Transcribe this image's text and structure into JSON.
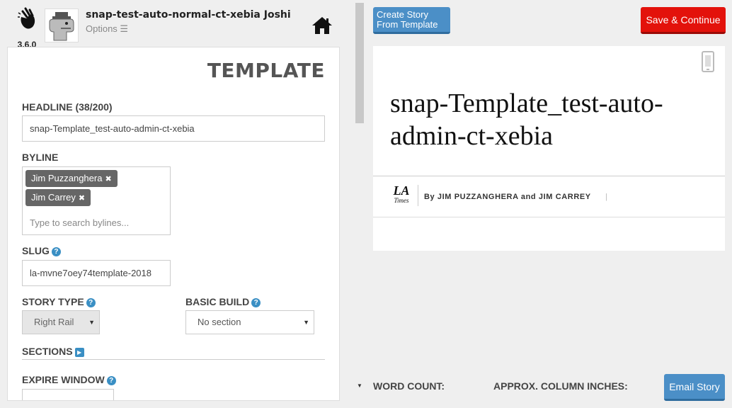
{
  "app": {
    "version": "3.6.0",
    "user_title": "snap-test-auto-normal-ct-xebia Joshi",
    "options_label": "Options ☰"
  },
  "panel": {
    "title": "TEMPLATE",
    "headline_label": "HEADLINE (38/200)",
    "headline_value": "snap-Template_test-auto-admin-ct-xebia",
    "byline_label": "BYLINE",
    "byline_tags": [
      "Jim Puzzanghera",
      "Jim Carrey"
    ],
    "byline_placeholder": "Type to search bylines...",
    "slug_label": "SLUG",
    "slug_value": "la-mvne7oey74template-2018",
    "story_type_label": "STORY TYPE",
    "story_type_value": "Right Rail",
    "basic_build_label": "BASIC BUILD",
    "basic_build_value": "No section",
    "sections_label": "SECTIONS",
    "expire_window_label": "EXPIRE WINDOW"
  },
  "toolbar": {
    "create_story_line1": "Create Story",
    "create_story_line2": "From Template",
    "save_continue": "Save & Continue"
  },
  "preview": {
    "headline": "snap-Template_test-auto-admin-ct-xebia",
    "logo_top": "LA",
    "logo_bottom": "Times",
    "byline": "By JIM PUZZANGHERA and JIM CARREY",
    "byline_sep": "|"
  },
  "footer": {
    "word_count": "WORD COUNT:",
    "column_inches": "APPROX. COLUMN INCHES:",
    "email_story": "Email Story"
  },
  "icons": {
    "logo": "snap-fingers-icon",
    "home": "home-icon",
    "help": "help-icon",
    "mobile": "mobile-icon"
  },
  "colors": {
    "primary_blue": "#4b8fc7",
    "save_red": "#e3120b",
    "help_blue": "#3a8fc4"
  }
}
